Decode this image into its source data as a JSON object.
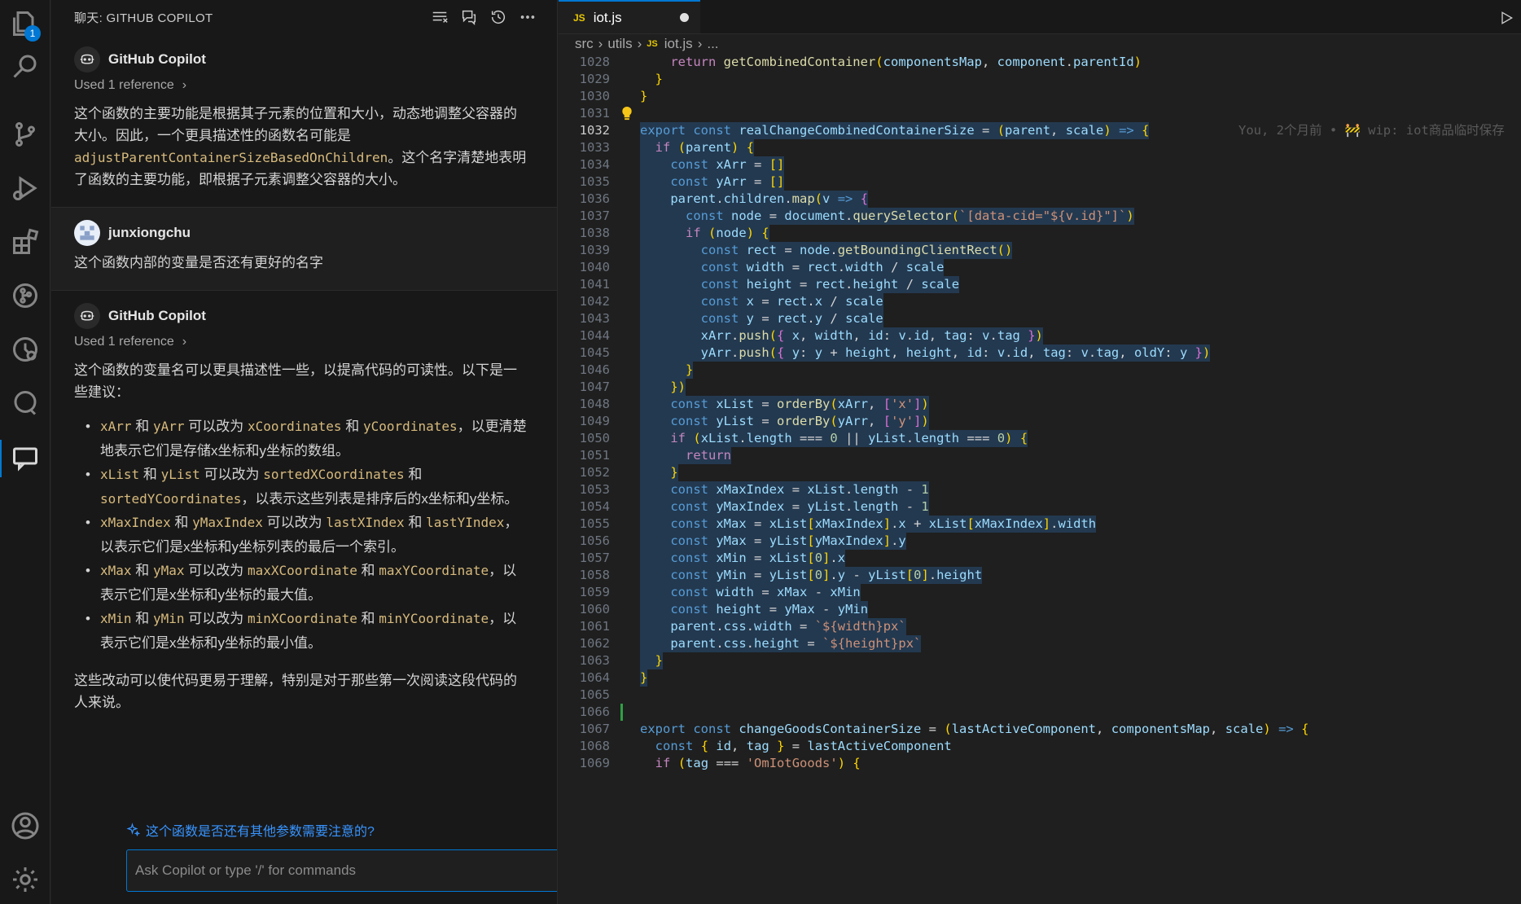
{
  "activity_bar": {
    "explorer_badge": "1",
    "items": [
      "explorer",
      "search",
      "source-control",
      "run-debug",
      "extensions",
      "git-graph",
      "timeline",
      "remote",
      "chat"
    ]
  },
  "chat": {
    "header_title": "聊天: GITHUB COPILOT",
    "messages": [
      {
        "author": "GitHub Copilot",
        "reference": "Used 1 reference",
        "text_before": "这个函数的主要功能是根据其子元素的位置和大小，动态地调整父容器的大小。因此，一个更具描述性的函数名可能是 ",
        "code": "adjustParentContainerSizeBasedOnChildren",
        "text_after": "。这个名字清楚地表明了函数的主要功能，即根据子元素调整父容器的大小。"
      },
      {
        "author": "junxiongchu",
        "text": "这个函数内部的变量是否还有更好的名字"
      },
      {
        "author": "GitHub Copilot",
        "reference": "Used 1 reference",
        "intro": "这个函数的变量名可以更具描述性一些，以提高代码的可读性。以下是一些建议：",
        "suggestions": [
          {
            "a": "xArr",
            "b": "yArr",
            "c": "xCoordinates",
            "d": "yCoordinates",
            "desc": "，以更清楚地表示它们是存储x坐标和y坐标的数组。"
          },
          {
            "a": "xList",
            "b": "yList",
            "c": "sortedXCoordinates",
            "d": "sortedYCoordinates",
            "desc": "，以表示这些列表是排序后的x坐标和y坐标。"
          },
          {
            "a": "xMaxIndex",
            "b": "yMaxIndex",
            "c": "lastXIndex",
            "d": "lastYIndex",
            "desc": "，以表示它们是x坐标和y坐标列表的最后一个索引。"
          },
          {
            "a": "xMax",
            "b": "yMax",
            "c": "maxXCoordinate",
            "d": "maxYCoordinate",
            "desc": "，以表示它们是x坐标和y坐标的最大值。"
          },
          {
            "a": "xMin",
            "b": "yMin",
            "c": "minXCoordinate",
            "d": "minYCoordinate",
            "desc": "，以表示它们是x坐标和y坐标的最小值。"
          }
        ],
        "connector_and": " 和 ",
        "connector_change": " 可以改为 ",
        "closing": "这些改动可以使代码更易于理解，特别是对于那些第一次阅读这段代码的人来说。"
      }
    ],
    "followup": "这个函数是否还有其他参数需要注意的?",
    "input_placeholder": "Ask Copilot or type '/' for commands"
  },
  "editor": {
    "tab": {
      "icon": "JS",
      "name": "iot.js"
    },
    "breadcrumb": [
      "src",
      "utils",
      "iot.js",
      "..."
    ],
    "blame": "You, 2个月前 • 🚧 wip: iot商品临时保存",
    "lines": [
      {
        "n": "1028",
        "c": "    return getCombinedContainer(componentsMap, component.parentId)"
      },
      {
        "n": "1029",
        "c": "  }"
      },
      {
        "n": "1030",
        "c": "}"
      },
      {
        "n": "1031",
        "c": ""
      },
      {
        "n": "1032",
        "c": "export const realChangeCombinedContainerSize = (parent, scale) => {"
      },
      {
        "n": "1033",
        "c": "  if (parent) {"
      },
      {
        "n": "1034",
        "c": "    const xArr = []"
      },
      {
        "n": "1035",
        "c": "    const yArr = []"
      },
      {
        "n": "1036",
        "c": "    parent.children.map(v => {"
      },
      {
        "n": "1037",
        "c": "      const node = document.querySelector(`[data-cid=\"${v.id}\"]`)"
      },
      {
        "n": "1038",
        "c": "      if (node) {"
      },
      {
        "n": "1039",
        "c": "        const rect = node.getBoundingClientRect()"
      },
      {
        "n": "1040",
        "c": "        const width = rect.width / scale"
      },
      {
        "n": "1041",
        "c": "        const height = rect.height / scale"
      },
      {
        "n": "1042",
        "c": "        const x = rect.x / scale"
      },
      {
        "n": "1043",
        "c": "        const y = rect.y / scale"
      },
      {
        "n": "1044",
        "c": "        xArr.push({ x, width, id: v.id, tag: v.tag })"
      },
      {
        "n": "1045",
        "c": "        yArr.push({ y: y + height, height, id: v.id, tag: v.tag, oldY: y })"
      },
      {
        "n": "1046",
        "c": "      }"
      },
      {
        "n": "1047",
        "c": "    })"
      },
      {
        "n": "1048",
        "c": "    const xList = orderBy(xArr, ['x'])"
      },
      {
        "n": "1049",
        "c": "    const yList = orderBy(yArr, ['y'])"
      },
      {
        "n": "1050",
        "c": "    if (xList.length === 0 || yList.length === 0) {"
      },
      {
        "n": "1051",
        "c": "      return"
      },
      {
        "n": "1052",
        "c": "    }"
      },
      {
        "n": "1053",
        "c": "    const xMaxIndex = xList.length - 1"
      },
      {
        "n": "1054",
        "c": "    const yMaxIndex = yList.length - 1"
      },
      {
        "n": "1055",
        "c": "    const xMax = xList[xMaxIndex].x + xList[xMaxIndex].width"
      },
      {
        "n": "1056",
        "c": "    const yMax = yList[yMaxIndex].y"
      },
      {
        "n": "1057",
        "c": "    const xMin = xList[0].x"
      },
      {
        "n": "1058",
        "c": "    const yMin = yList[0].y - yList[0].height"
      },
      {
        "n": "1059",
        "c": "    const width = xMax - xMin"
      },
      {
        "n": "1060",
        "c": "    const height = yMax - yMin"
      },
      {
        "n": "1061",
        "c": "    parent.css.width = `${width}px`"
      },
      {
        "n": "1062",
        "c": "    parent.css.height = `${height}px`"
      },
      {
        "n": "1063",
        "c": "  }"
      },
      {
        "n": "1064",
        "c": "}"
      },
      {
        "n": "1065",
        "c": ""
      },
      {
        "n": "1066",
        "c": ""
      },
      {
        "n": "1067",
        "c": "export const changeGoodsContainerSize = (lastActiveComponent, componentsMap, scale) => {"
      },
      {
        "n": "1068",
        "c": "  const { id, tag } = lastActiveComponent"
      },
      {
        "n": "1069",
        "c": "  if (tag === 'OmIotGoods') {"
      }
    ]
  },
  "colors": {
    "accent": "#0078d4",
    "keyword": "#569cd6",
    "function": "#dcdcaa",
    "variable": "#9cdcfe",
    "string": "#ce9178",
    "inline_code": "#d7ba7d",
    "link": "#3794ff"
  }
}
